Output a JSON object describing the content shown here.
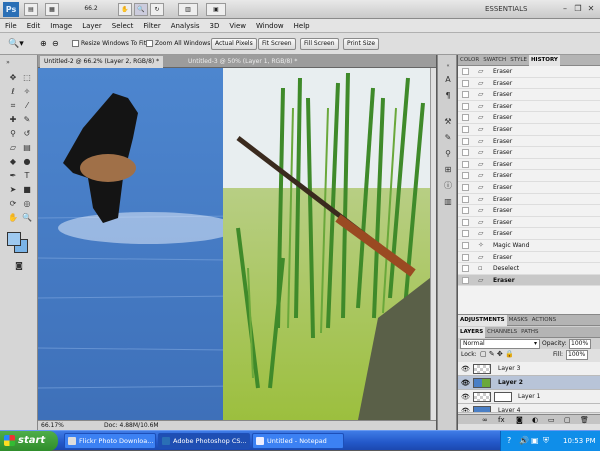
{
  "app": {
    "logo": "Ps",
    "zoom": "66.2",
    "workspace": "ESSENTIALS"
  },
  "menu": [
    "File",
    "Edit",
    "Image",
    "Layer",
    "Select",
    "Filter",
    "Analysis",
    "3D",
    "View",
    "Window",
    "Help"
  ],
  "options": {
    "resize_label": "Resize Windows To Fit",
    "zoom_all_label": "Zoom All Windows",
    "buttons": [
      "Actual Pixels",
      "Fit Screen",
      "Fill Screen",
      "Print Size"
    ]
  },
  "doc_tabs": [
    {
      "label": "Untitled-2 @ 66.2% (Layer 2, RGB/8) *",
      "active": true
    },
    {
      "label": "Untitled-3 @ 50% (Layer 1, RGB/8) *",
      "active": false
    }
  ],
  "status": {
    "zoom": "66.17%",
    "doc": "Doc: 4.88M/10.6M"
  },
  "panels": {
    "top_tabs": [
      "COLOR",
      "SWATCH",
      "STYLE",
      "HISTORY"
    ],
    "history": [
      "Eraser",
      "Eraser",
      "Eraser",
      "Eraser",
      "Eraser",
      "Eraser",
      "Eraser",
      "Eraser",
      "Eraser",
      "Eraser",
      "Eraser",
      "Eraser",
      "Eraser",
      "Eraser",
      "Eraser",
      "Magic Wand",
      "Eraser",
      "Deselect",
      "Eraser"
    ],
    "mid_tabs": [
      "ADJUSTMENTS",
      "MASKS",
      "ACTIONS"
    ],
    "layer_tabs": [
      "LAYERS",
      "CHANNELS",
      "PATHS"
    ],
    "blend_mode": "Normal",
    "opacity_label": "Opacity:",
    "opacity": "100%",
    "lock_label": "Lock:",
    "fill_label": "Fill:",
    "fill": "100%",
    "layers": [
      {
        "name": "Layer 3"
      },
      {
        "name": "Layer 2",
        "selected": true
      },
      {
        "name": "Layer 1"
      },
      {
        "name": "Layer 4"
      }
    ]
  },
  "taskbar": {
    "start": "start",
    "tasks": [
      {
        "label": "Flickr Photo Downloa..."
      },
      {
        "label": "Adobe Photoshop CS...",
        "active": true
      },
      {
        "label": "Untitled - Notepad"
      }
    ],
    "clock": "10:53 PM"
  }
}
